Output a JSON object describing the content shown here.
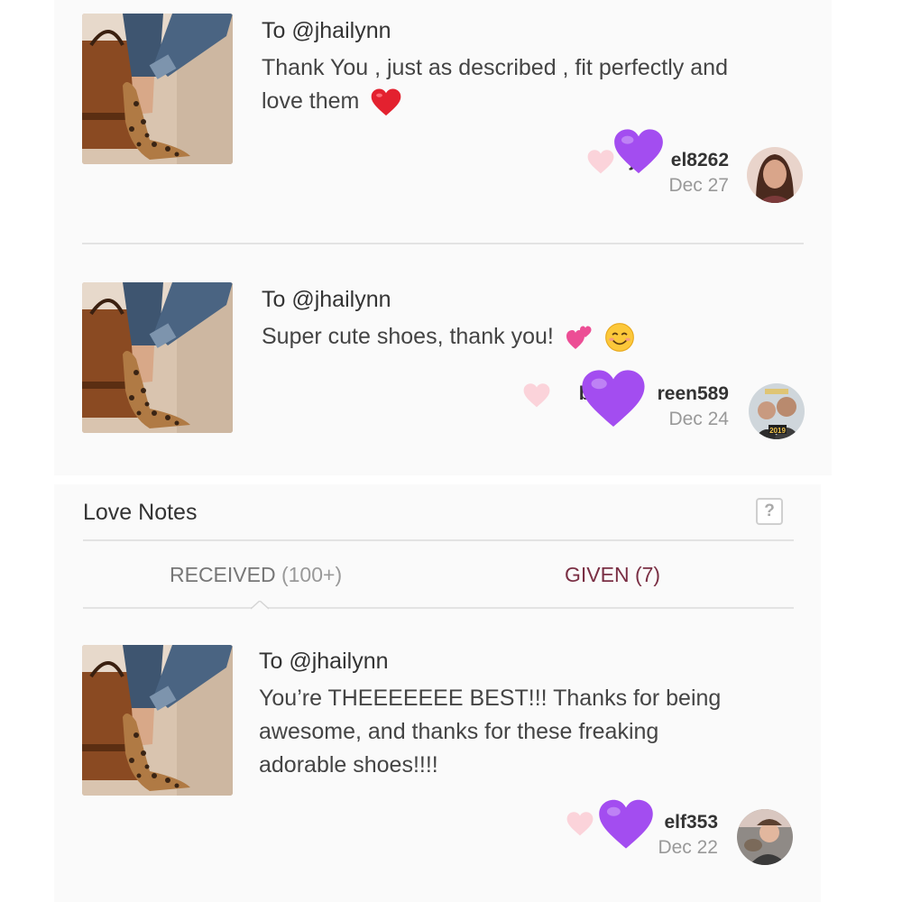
{
  "notes_top": [
    {
      "to": "To @jhailynn",
      "message": "Thank You , just as described , fit perfectly and love them",
      "message_line1": "Thank You , just as described , fit perfectly and",
      "message_line2": "love them",
      "emoji": "red-heart",
      "author_visible": "el8262",
      "author_prefix": "j",
      "date": "Dec 27"
    },
    {
      "to": "To @jhailynn",
      "message": "Super cute shoes, thank you!",
      "emoji": [
        "two-hearts",
        "smiling-face"
      ],
      "author_prefix": "bri",
      "author_visible": "reen589",
      "date": "Dec 24"
    }
  ],
  "love_notes": {
    "title": "Love Notes",
    "help_label": "?",
    "tabs": {
      "received_label": "RECEIVED",
      "received_count": "(100+)",
      "given_label": "GIVEN (7)"
    },
    "note": {
      "to": "To @jhailynn",
      "message_line1": "You’re THEEEEEEE BEST!!! Thanks for being",
      "message_line2": "awesome, and thanks for these freaking",
      "message_line3": "adorable shoes!!!!",
      "author_visible": "elf353",
      "date": "Dec 22"
    }
  },
  "colors": {
    "heart_pink": "#fbd3da",
    "purple_heart": "#a34df0",
    "given_tab": "#7a2f44",
    "panel_bg": "#fafafa"
  },
  "icons": [
    "shoe-thumbnail",
    "like-heart-icon",
    "purple-heart-sticker",
    "help-icon",
    "avatar"
  ]
}
